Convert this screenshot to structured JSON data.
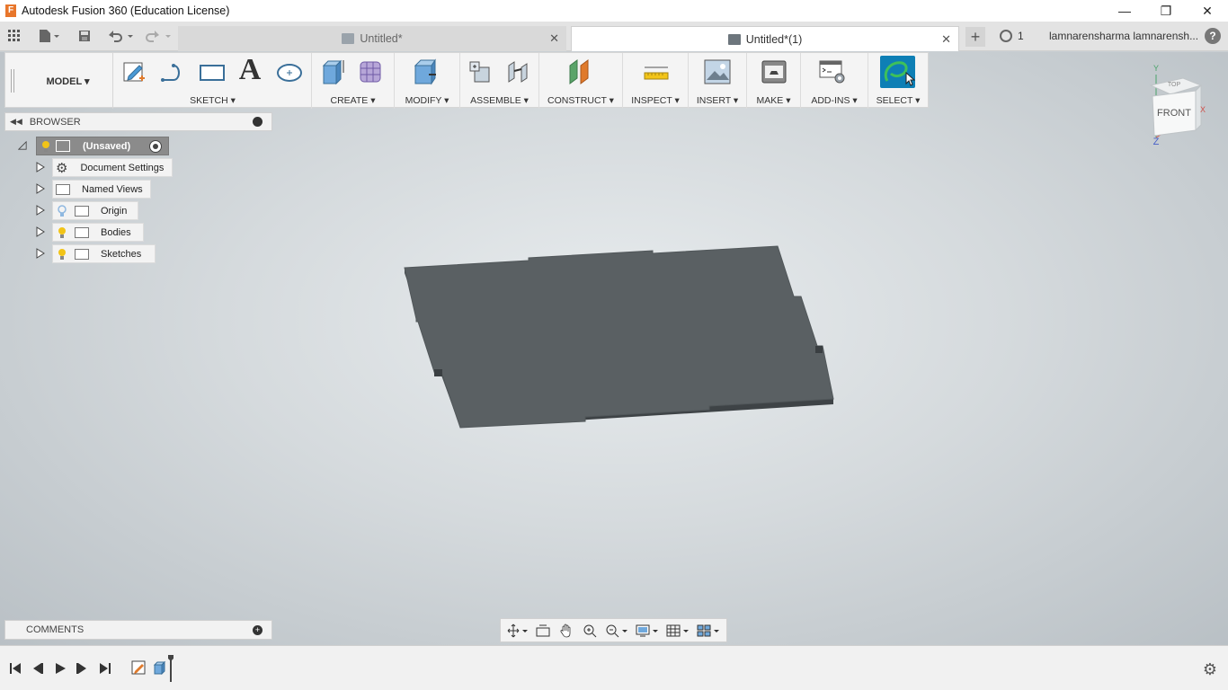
{
  "window": {
    "title": "Autodesk Fusion 360 (Education License)",
    "app_icon_letter": "F",
    "minimize": "—",
    "restore": "❐",
    "close": "✕"
  },
  "tabs": [
    {
      "label": "Untitled*",
      "active": false
    },
    {
      "label": "Untitled*(1)",
      "active": true
    }
  ],
  "tab_close_glyph": "✕",
  "new_tab_glyph": "+",
  "job_status": {
    "count": "1"
  },
  "user": {
    "name": "lamnarensharma lamnarensh..."
  },
  "help_label": "?",
  "workspace": {
    "label": "MODEL ▾"
  },
  "toolbar_groups": [
    {
      "label": "SKETCH ▾"
    },
    {
      "label": "CREATE ▾"
    },
    {
      "label": "MODIFY ▾"
    },
    {
      "label": "ASSEMBLE ▾"
    },
    {
      "label": "CONSTRUCT ▾"
    },
    {
      "label": "INSPECT ▾"
    },
    {
      "label": "INSERT ▾"
    },
    {
      "label": "MAKE ▾"
    },
    {
      "label": "ADD-INS ▾"
    },
    {
      "label": "SELECT ▾"
    }
  ],
  "sketch_text_glyph": "A",
  "browser": {
    "title": "BROWSER",
    "root": "(Unsaved)",
    "items": [
      {
        "label": "Document Settings"
      },
      {
        "label": "Named Views"
      },
      {
        "label": "Origin"
      },
      {
        "label": "Bodies"
      },
      {
        "label": "Sketches"
      }
    ]
  },
  "comments": {
    "title": "COMMENTS"
  },
  "viewcube": {
    "face_label": "FRONT",
    "top_label": "TOP",
    "axis_y": "Y",
    "axis_z": "Z",
    "axis_x": "X"
  },
  "colors": {
    "accent": "#0e7fb5",
    "bulb_on": "#f2c418",
    "bulb_off": "#8fb8e0",
    "body": "#5a6063",
    "body_edge": "#3e4346"
  }
}
